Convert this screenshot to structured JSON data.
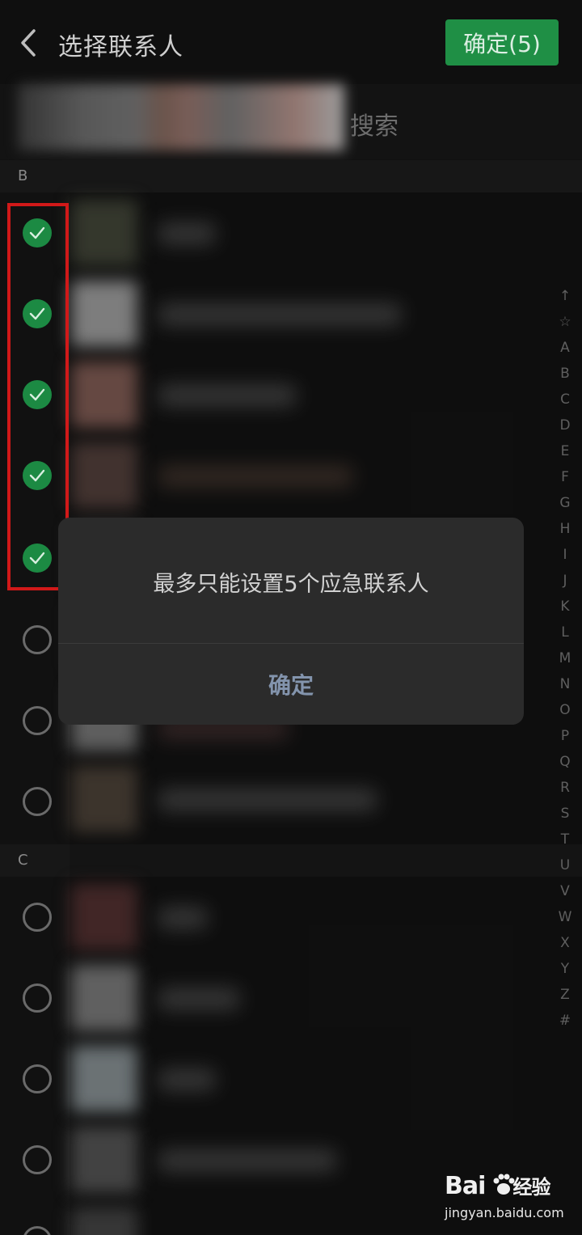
{
  "header": {
    "title": "选择联系人",
    "confirm_label": "确定(5)"
  },
  "search": {
    "placeholder": "搜索"
  },
  "sections": [
    {
      "letter": "B"
    },
    {
      "letter": "C"
    }
  ],
  "contacts": [
    {
      "section": "B",
      "checked": true
    },
    {
      "section": "B",
      "checked": true
    },
    {
      "section": "B",
      "checked": true
    },
    {
      "section": "B",
      "checked": true
    },
    {
      "section": "B",
      "checked": true
    },
    {
      "section": "B",
      "checked": false
    },
    {
      "section": "B",
      "checked": false
    },
    {
      "section": "B",
      "checked": false
    },
    {
      "section": "C",
      "checked": false
    },
    {
      "section": "C",
      "checked": false
    },
    {
      "section": "C",
      "checked": false
    },
    {
      "section": "C",
      "checked": false
    },
    {
      "section": "C",
      "checked": false
    }
  ],
  "index_bar": [
    "↑",
    "☆",
    "A",
    "B",
    "C",
    "D",
    "E",
    "F",
    "G",
    "H",
    "I",
    "J",
    "K",
    "L",
    "M",
    "N",
    "O",
    "P",
    "Q",
    "R",
    "S",
    "T",
    "U",
    "V",
    "W",
    "X",
    "Y",
    "Z",
    "#"
  ],
  "dialog": {
    "message": "最多只能设置5个应急联系人",
    "button_label": "确定"
  },
  "watermark": {
    "logo": "Bai",
    "logo_suffix": "经验",
    "url": "jingyan.baidu.com"
  },
  "colors": {
    "accent_green": "#1f8f45",
    "dialog_bg": "#2b2b2b",
    "highlight_red": "#d11919",
    "dialog_button": "#8394ad"
  }
}
